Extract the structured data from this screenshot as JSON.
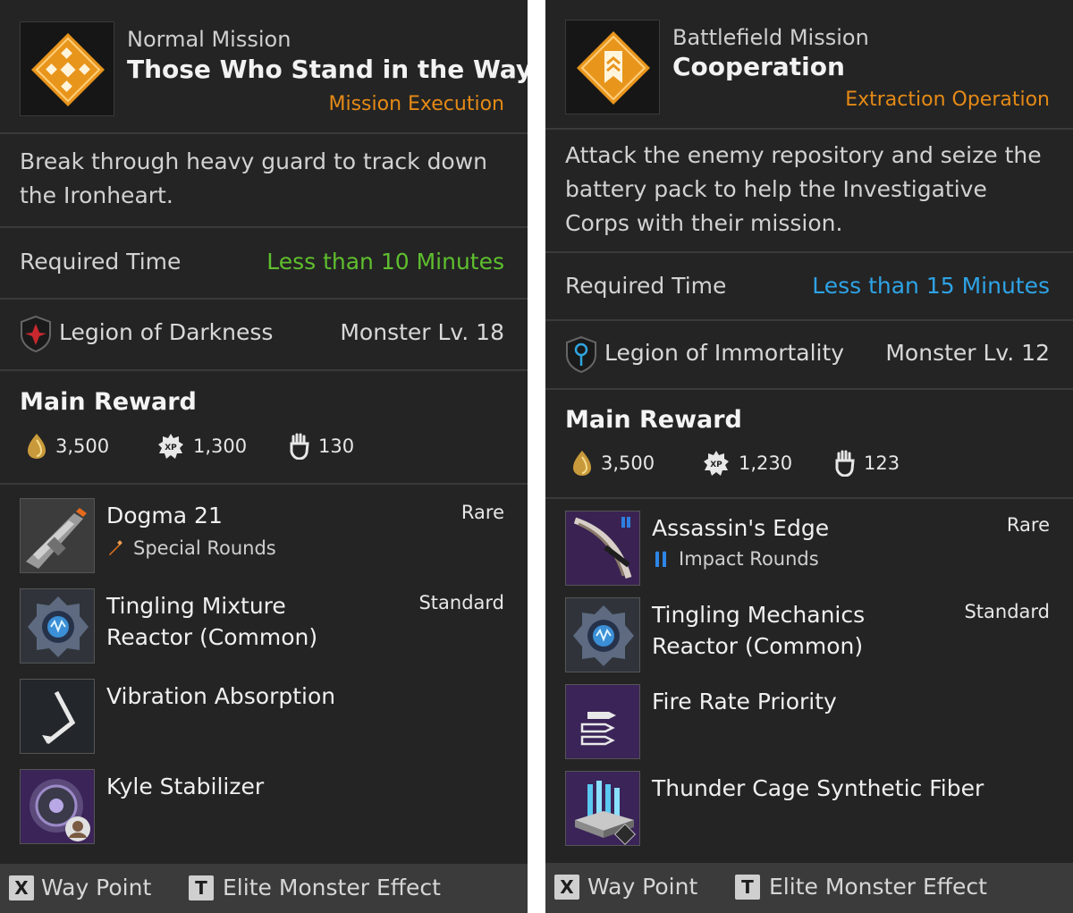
{
  "panels": [
    {
      "mission_type": "Normal Mission",
      "mission_title": "Those Who Stand in the Way",
      "mission_category": "Mission Execution",
      "description": "Break through heavy guard to track down the Ironheart.",
      "required_time_label": "Required Time",
      "required_time_value": "Less than 10 Minutes",
      "required_time_color": "#5fbf2e",
      "faction": "Legion of Darkness",
      "faction_icon": "legion-darkness-icon",
      "monster_level": "Monster Lv. 18",
      "main_reward_title": "Main Reward",
      "currencies": {
        "gold": "3,500",
        "xp": "1,300",
        "mastery": "130"
      },
      "items": [
        {
          "name": "Dogma 21",
          "grade": "Rare",
          "sub": "Special Rounds",
          "sub_icon": "special-rounds-icon",
          "thumb": "gun-thumbnail"
        },
        {
          "name": "Tingling Mixture Reactor (Common)",
          "grade": "Standard",
          "sub": "",
          "thumb": "reactor-thumbnail"
        },
        {
          "name": "Vibration Absorption",
          "grade": "",
          "sub": "",
          "thumb": "module-thumbnail"
        },
        {
          "name": "Kyle Stabilizer",
          "grade": "",
          "sub": "",
          "thumb": "component-thumbnail"
        }
      ],
      "footer": {
        "key1": "X",
        "label1": "Way Point",
        "key2": "T",
        "label2": "Elite Monster Effect"
      }
    },
    {
      "mission_type": "Battlefield Mission",
      "mission_title": "Cooperation",
      "mission_category": "Extraction Operation",
      "description": "Attack the enemy repository and seize the battery pack to help the Investigative Corps with their mission.",
      "required_time_label": "Required Time",
      "required_time_value": "Less than 15 Minutes",
      "required_time_color": "#2ea3e6",
      "faction": "Legion of Immortality",
      "faction_icon": "legion-immortality-icon",
      "monster_level": "Monster Lv. 12",
      "main_reward_title": "Main Reward",
      "currencies": {
        "gold": "3,500",
        "xp": "1,230",
        "mastery": "123"
      },
      "items": [
        {
          "name": "Assassin's Edge",
          "grade": "Rare",
          "sub": "Impact Rounds",
          "sub_icon": "impact-rounds-icon",
          "thumb": "crossbow-thumbnail"
        },
        {
          "name": "Tingling Mechanics Reactor (Common)",
          "grade": "Standard",
          "sub": "",
          "thumb": "reactor-thumbnail"
        },
        {
          "name": "Fire Rate Priority",
          "grade": "",
          "sub": "",
          "thumb": "bullets-module-thumbnail"
        },
        {
          "name": "Thunder Cage Synthetic Fiber",
          "grade": "",
          "sub": "",
          "thumb": "material-thumbnail"
        }
      ],
      "footer": {
        "key1": "X",
        "label1": "Way Point",
        "key2": "T",
        "label2": "Elite Monster Effect"
      }
    }
  ]
}
